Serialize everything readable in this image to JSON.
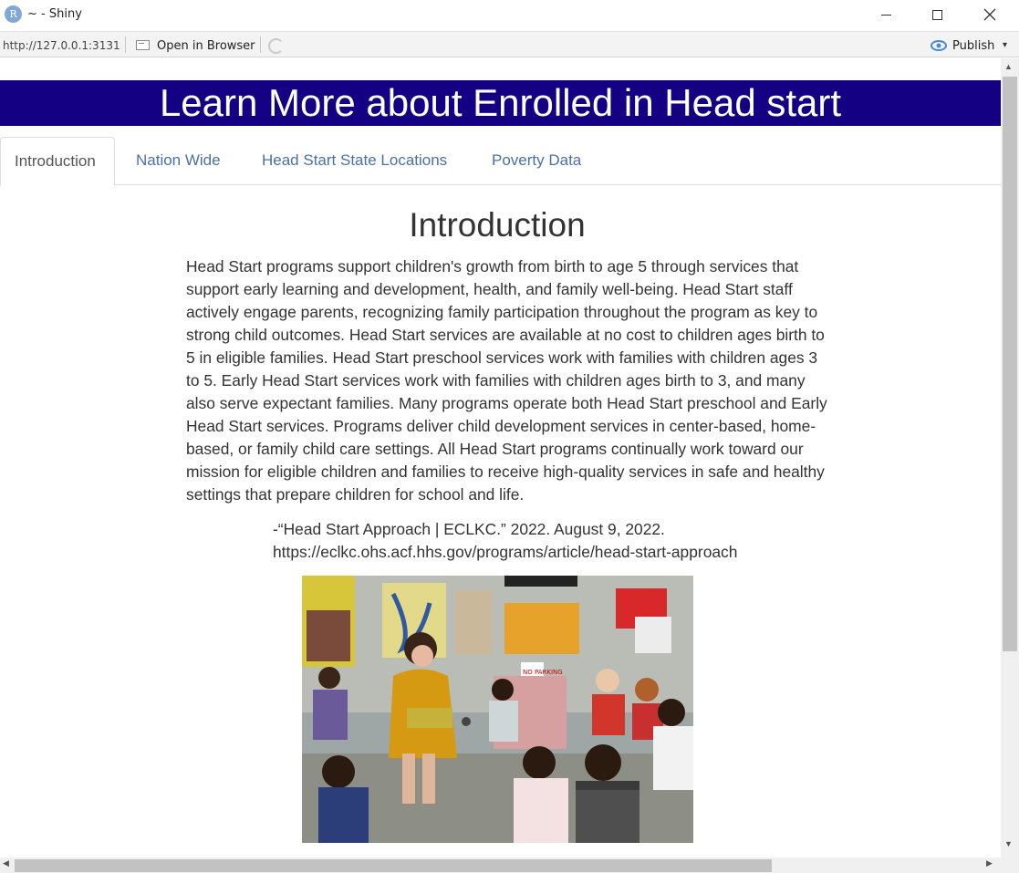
{
  "window": {
    "title": "~ - Shiny",
    "app_icon_letter": "R"
  },
  "toolbar": {
    "url": "http://127.0.0.1:3131",
    "open_in_browser_label": "Open in Browser",
    "publish_label": "Publish"
  },
  "page": {
    "banner_title": "Learn More about Enrolled in Head start",
    "tabs": [
      {
        "label": "Introduction",
        "active": true
      },
      {
        "label": "Nation Wide",
        "active": false
      },
      {
        "label": "Head Start State Locations",
        "active": false
      },
      {
        "label": "Poverty Data",
        "active": false
      }
    ],
    "intro": {
      "heading": "Introduction",
      "body": "Head Start programs support children's growth from birth to age 5 through services that support early learning and development, health, and family well-being. Head Start staff actively engage parents, recognizing family participation throughout the program as key to strong child outcomes. Head Start services are available at no cost to children ages birth to 5 in eligible families. Head Start preschool services work with families with children ages 3 to 5. Early Head Start services work with families with children ages birth to 3, and many also serve expectant families. Many programs operate both Head Start preschool and Early Head Start services. Programs deliver child development services in center-based, home-based, or family child care settings. All Head Start programs continually work toward our mission for eligible children and families to receive high-quality services in safe and healthy settings that prepare children for school and life.",
      "citation_line1": "-“Head Start Approach | ECLKC.” 2022. August 9, 2022.",
      "citation_line2": "https://eclkc.ohs.acf.hhs.gov/programs/article/head-start-approach",
      "photo_sign_text": "NO PARKING"
    }
  },
  "colors": {
    "banner_bg": "#140082",
    "tab_link": "#4a70a8",
    "text": "#333333"
  }
}
